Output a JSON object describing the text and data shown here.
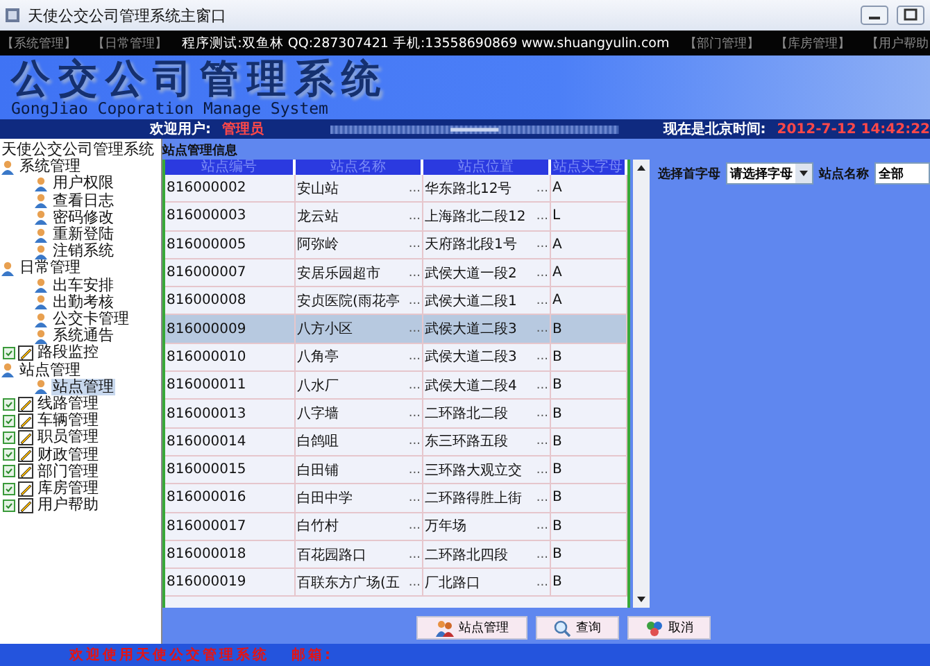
{
  "window": {
    "title": "天使公交公司管理系统主窗口"
  },
  "menu": {
    "items": [
      "【系统管理】",
      "【日常管理】",
      "【部门管理】",
      "【库房管理】",
      "【用户帮助"
    ],
    "overlay": "程序测试:双鱼林 QQ:287307421 手机:13558690869 www.shuangyulin.com"
  },
  "banner": {
    "title": "公交公司管理系统",
    "subtitle": "GongJiao Coporation Manage System"
  },
  "info": {
    "welcome_label": "欢迎用户:",
    "user": "管理员",
    "time_label": "现在是北京时间:",
    "time": "2012-7-12 14:42:22"
  },
  "tree": {
    "label": "天使公交公司管理系统",
    "children": [
      {
        "label": "系统管理",
        "expanded": true,
        "children": [
          {
            "label": "用户权限",
            "selected": false
          },
          {
            "label": "查看日志",
            "selected": false
          },
          {
            "label": "密码修改",
            "selected": false
          },
          {
            "label": "重新登陆",
            "selected": false
          },
          {
            "label": "注销系统",
            "selected": false
          }
        ]
      },
      {
        "label": "日常管理",
        "expanded": true,
        "children": [
          {
            "label": "出车安排",
            "selected": false
          },
          {
            "label": "出勤考核",
            "selected": false
          },
          {
            "label": "公交卡管理",
            "selected": false
          },
          {
            "label": "系统通告",
            "selected": false
          }
        ]
      },
      {
        "label": "路段监控",
        "expanded": false
      },
      {
        "label": "站点管理",
        "expanded": true,
        "children": [
          {
            "label": "站点管理",
            "selected": true
          }
        ]
      },
      {
        "label": "线路管理",
        "expanded": false
      },
      {
        "label": "车辆管理",
        "expanded": false
      },
      {
        "label": "职员管理",
        "expanded": false
      },
      {
        "label": "财政管理",
        "expanded": false
      },
      {
        "label": "部门管理",
        "expanded": false
      },
      {
        "label": "库房管理",
        "expanded": false
      },
      {
        "label": "用户帮助",
        "expanded": false
      }
    ]
  },
  "panel": {
    "caption": "站点管理信息"
  },
  "table": {
    "columns": [
      {
        "label": "站点编号"
      },
      {
        "label": "站点名称",
        "cell_button": "..."
      },
      {
        "label": "站点位置",
        "cell_button": "..."
      },
      {
        "label": "站点头字母"
      }
    ],
    "rows": [
      {
        "cells": [
          "816000002",
          "安山站",
          "华东路北12号",
          "A"
        ],
        "selected": false
      },
      {
        "cells": [
          "816000003",
          "龙云站",
          "上海路北二段12",
          "L"
        ],
        "selected": false
      },
      {
        "cells": [
          "816000005",
          "阿弥岭",
          "天府路北段1号",
          "A"
        ],
        "selected": false
      },
      {
        "cells": [
          "816000007",
          "安居乐园超市",
          "武侯大道一段2",
          "A"
        ],
        "selected": false
      },
      {
        "cells": [
          "816000008",
          "安贞医院(雨花亭",
          "武侯大道二段1",
          "A"
        ],
        "selected": false
      },
      {
        "cells": [
          "816000009",
          "八方小区",
          "武侯大道二段3",
          "B"
        ],
        "selected": true
      },
      {
        "cells": [
          "816000010",
          "八角亭",
          "武侯大道二段3",
          "B"
        ],
        "selected": false
      },
      {
        "cells": [
          "816000011",
          "八水厂",
          "武侯大道二段4",
          "B"
        ],
        "selected": false
      },
      {
        "cells": [
          "816000013",
          "八字墙",
          "二环路北二段",
          "B"
        ],
        "selected": false
      },
      {
        "cells": [
          "816000014",
          "白鸽咀",
          "东三环路五段",
          "B"
        ],
        "selected": false
      },
      {
        "cells": [
          "816000015",
          "白田铺",
          "三环路大观立交",
          "B"
        ],
        "selected": false
      },
      {
        "cells": [
          "816000016",
          "白田中学",
          "二环路得胜上街",
          "B"
        ],
        "selected": false
      },
      {
        "cells": [
          "816000017",
          "白竹村",
          "万年场",
          "B"
        ],
        "selected": false
      },
      {
        "cells": [
          "816000018",
          "百花园路口",
          "二环路北四段",
          "B"
        ],
        "selected": false
      },
      {
        "cells": [
          "816000019",
          "百联东方广场(五",
          "厂北路口",
          "B"
        ],
        "selected": false
      }
    ]
  },
  "filter": {
    "letter_label": "选择首字母",
    "letter_value": "请选择字母",
    "name_label": "站点名称",
    "name_value": "全部"
  },
  "buttons": [
    {
      "label": "站点管理",
      "kind": "manage"
    },
    {
      "label": "查询",
      "kind": "search"
    },
    {
      "label": "取消",
      "kind": "cancel"
    }
  ],
  "status_bar": {
    "text": "欢迎使用天使公交管理系统",
    "email_label": "邮箱:"
  }
}
